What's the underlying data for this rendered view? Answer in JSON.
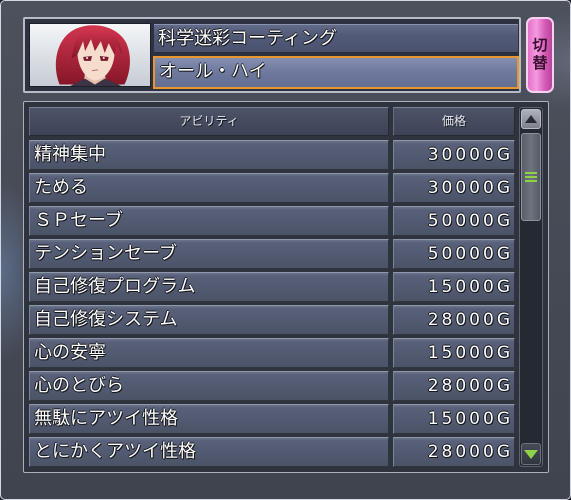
{
  "header": {
    "title": "科学迷彩コーティング",
    "selected_name": "オール・ハイ"
  },
  "portrait": {
    "icon": "pilot-portrait-icon",
    "hair_color": "#b8283e"
  },
  "switch_button": {
    "label": "切替",
    "color": "#d860b8"
  },
  "table": {
    "columns": {
      "ability": "アビリティ",
      "price": "価格"
    },
    "rows": [
      {
        "name": "精神集中",
        "price": "30000G"
      },
      {
        "name": "ためる",
        "price": "30000G"
      },
      {
        "name": "ＳＰセーブ",
        "price": "50000G"
      },
      {
        "name": "テンションセーブ",
        "price": "50000G"
      },
      {
        "name": "自己修復プログラム",
        "price": "15000G"
      },
      {
        "name": "自己修復システム",
        "price": "28000G"
      },
      {
        "name": "心の安寧",
        "price": "15000G"
      },
      {
        "name": "心のとびら",
        "price": "28000G"
      },
      {
        "name": "無駄にアツイ性格",
        "price": "15000G"
      },
      {
        "name": "とにかくアツイ性格",
        "price": "28000G"
      }
    ]
  },
  "scrollbar": {
    "scroll_fraction": 0,
    "icons": {
      "up": "triangle-up-icon",
      "down": "triangle-down-icon",
      "grip": "grip-lines-icon"
    }
  },
  "colors": {
    "selected_border": "#e8962e",
    "scroll_accent": "#8fd24a"
  }
}
